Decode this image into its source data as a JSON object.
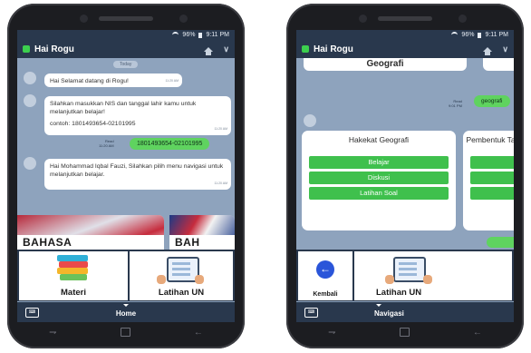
{
  "left_phone": {
    "status": {
      "battery": "96%",
      "time": "9:11 PM"
    },
    "appbar": {
      "title": "Hai Rogu"
    },
    "chat": {
      "date_label": "Today",
      "messages": [
        {
          "text": "Hai Selamat datang di Rogu!",
          "time": "11:20 AM"
        },
        {
          "text": "Silahkan masukkan NIS dan tanggal lahir kamu untuk melanjutkan belajar!",
          "sub": "contoh: 1801493654-02101995",
          "time": "11:20 AM"
        },
        {
          "text": "Hai Mohammad Iqbal Fauzi, Silahkan pilih menu navigasi untuk melanjutkan belajar.",
          "time": "11:20 AM"
        }
      ],
      "outgoing": {
        "text": "1801493654-02101995",
        "read": "Read",
        "time": "11:20 AM"
      }
    },
    "banners": [
      {
        "label": "BAHASA"
      },
      {
        "label": "BAH"
      }
    ],
    "menu": [
      {
        "label": "Materi"
      },
      {
        "label": "Latihan UN"
      }
    ],
    "bottombar": {
      "label": "Home"
    }
  },
  "right_phone": {
    "status": {
      "battery": "96%",
      "time": "9:11 PM"
    },
    "appbar": {
      "title": "Hai Rogu"
    },
    "top_card": {
      "label": "Geografi"
    },
    "outgoing": {
      "text": "geografi",
      "read": "Read",
      "time": "9:01 PM"
    },
    "cards": [
      {
        "title": "Hakekat Geografi",
        "buttons": [
          "Belajar",
          "Diskusi",
          "Latihan Soal"
        ]
      },
      {
        "title": "Pembentuk Tatasur",
        "buttons": [
          "",
          "",
          "La"
        ]
      }
    ],
    "menu": [
      {
        "label": "Kembali"
      },
      {
        "label": "Latihan UN"
      }
    ],
    "bottombar": {
      "label": "Navigasi"
    }
  },
  "colors": {
    "appbar": "#29384d",
    "chat_bg": "#8ea3bd",
    "green": "#3fc04d",
    "bubble_out": "#5fd35f"
  }
}
